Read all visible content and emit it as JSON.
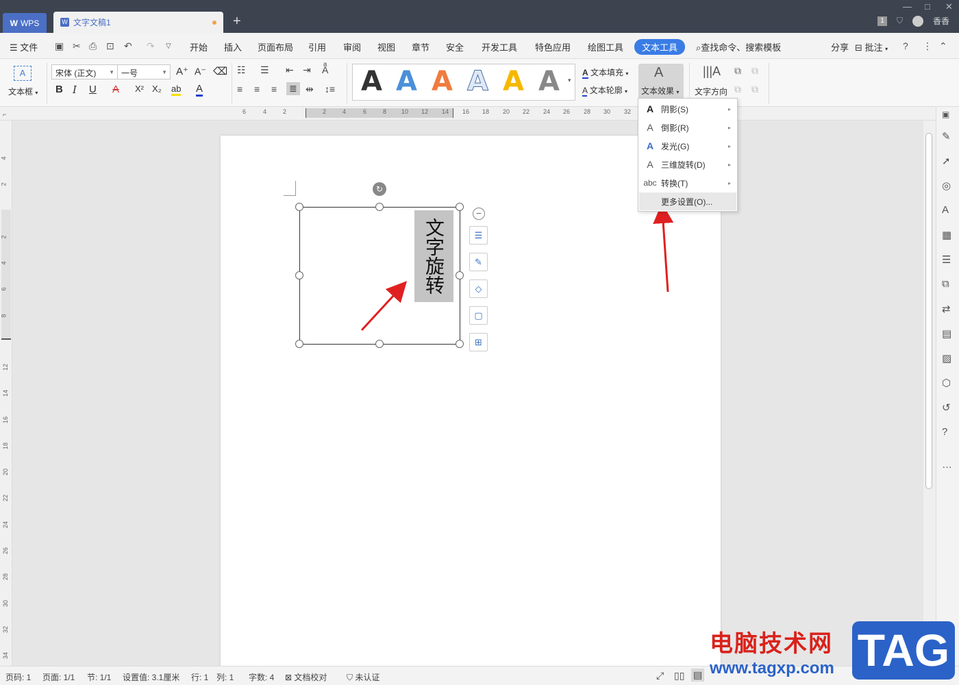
{
  "titlebar": {
    "wps_label": "WPS",
    "doc_tab": "文字文稿1",
    "new_tab": "+",
    "user_name": "香香",
    "badge": "1"
  },
  "menubar": {
    "file": "文件",
    "items": [
      "开始",
      "插入",
      "页面布局",
      "引用",
      "审阅",
      "视图",
      "章节",
      "安全",
      "开发工具",
      "特色应用",
      "绘图工具",
      "文本工具"
    ],
    "search": "查找命令、搜索模板",
    "share": "分享",
    "comment": "批注"
  },
  "ribbon": {
    "textbox": "文本框",
    "font_name": "宋体 (正文)",
    "font_size": "一号",
    "text_fill": "文本填充",
    "text_outline": "文本轮廓",
    "text_effect": "文本效果",
    "text_direction": "文字方向",
    "style_glyph": "A",
    "style_colors": [
      "#000000",
      "#4a90d9",
      "#f07b3f",
      "#dfe8f6",
      "#f5b800",
      "#888888"
    ]
  },
  "ruler": {
    "h_ticks": [
      "6",
      "4",
      "2",
      "2",
      "4",
      "6",
      "8",
      "10",
      "12",
      "14",
      "16",
      "18",
      "20",
      "22",
      "24",
      "26",
      "28",
      "30",
      "32"
    ],
    "v_ticks": [
      "4",
      "2",
      "2",
      "4",
      "6",
      "8",
      "12",
      "14",
      "16",
      "18",
      "20",
      "22",
      "24",
      "26",
      "28",
      "30",
      "32",
      "34"
    ]
  },
  "document": {
    "vertical_text": "文字旋转"
  },
  "dropdown": {
    "items": [
      {
        "label": "阴影(S)",
        "icon": "shadow-a-icon"
      },
      {
        "label": "倒影(R)",
        "icon": "reflection-a-icon"
      },
      {
        "label": "发光(G)",
        "icon": "glow-a-icon"
      },
      {
        "label": "三维旋转(D)",
        "icon": "3d-rotation-a-icon"
      },
      {
        "label": "转换(T)",
        "icon": "transform-abc-icon",
        "glyph": "abc"
      },
      {
        "label": "更多设置(O)..."
      }
    ]
  },
  "statusbar": {
    "page_num": "页码: 1",
    "page": "页面: 1/1",
    "section": "节: 1/1",
    "setting": "设置值: 3.1厘米",
    "row": "行: 1",
    "col": "列: 1",
    "words": "字数: 4",
    "proof": "文档校对",
    "cert": "未认证"
  },
  "watermark": {
    "cn": "电脑技术网",
    "url": "www.tagxp.com",
    "tag": "TAG"
  },
  "colors": {
    "accent": "#3a7ce5",
    "titlebar": "#3d4450",
    "arrow": "#e02020"
  }
}
